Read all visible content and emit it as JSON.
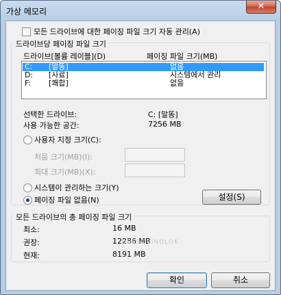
{
  "window": {
    "title": "가상 메모리",
    "close_glyph": "✕"
  },
  "auto_manage": {
    "label": "모든 드라이브에 대한 페이징 파일 크기 자동 관리(A)",
    "checked": false
  },
  "per_drive": {
    "group_title": "드라이브당 페이징 파일 크기",
    "col_drive": "드라이브[볼륨 레이블](D)",
    "col_size": "페이징 파일 크기(MB)",
    "drives": [
      {
        "letter": "C:",
        "label": "[말똥]",
        "size": "없음",
        "selected": true
      },
      {
        "letter": "D:",
        "label": "[사료]",
        "size": "시스템에서 관리",
        "selected": false
      },
      {
        "letter": "F:",
        "label": "[쾌합]",
        "size": "없음",
        "selected": false
      }
    ],
    "selected_drive_label": "선택한 드라이브:",
    "selected_drive_value": "C:  [말똥]",
    "available_label": "사용 가능한 공간:",
    "available_value": "7256 MB",
    "custom_size_label": "사용자 지정 크기(C):",
    "initial_label": "처음 크기(MB)(I):",
    "initial_value": "",
    "max_label": "최대 크기(MB)(X):",
    "max_value": "",
    "system_managed_label": "시스템이 관리하는 크기(Y)",
    "no_paging_label": "페이징 파일 없음(N)",
    "selected_option": "no_paging",
    "set_button": "설정(S)"
  },
  "totals": {
    "group_title": "모든 드라이브의 총 페이징 파일 크기",
    "min_label": "최소:",
    "min_value": "16 MB",
    "recommended_label": "권장:",
    "recommended_value": "12286 MB",
    "current_label": "현재:",
    "current_value": "8191 MB"
  },
  "watermark": "OBESOVINOLOK",
  "ok_button": "확인",
  "cancel_button": "취소"
}
